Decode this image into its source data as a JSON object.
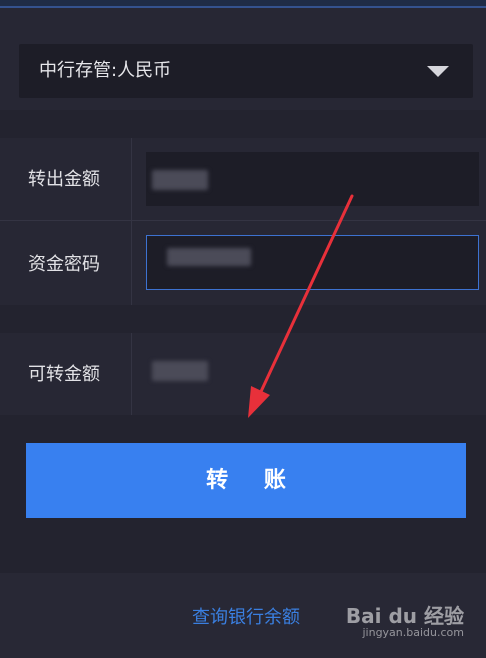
{
  "account_select": {
    "selected_value": "中行存管:人民币"
  },
  "form": {
    "transfer_out_amount_label": "转出金额",
    "fund_password_label": "资金密码"
  },
  "available": {
    "label": "可转金额"
  },
  "actions": {
    "transfer_button": "转 账",
    "query_bank_balance_link": "查询银行余额"
  },
  "watermark": {
    "logo_text": "Bai du 经验",
    "url": "jingyan.baidu.com"
  },
  "colors": {
    "accent_blue": "#3880f0",
    "annotation_arrow": "#e8303a",
    "background": "#23232f"
  }
}
